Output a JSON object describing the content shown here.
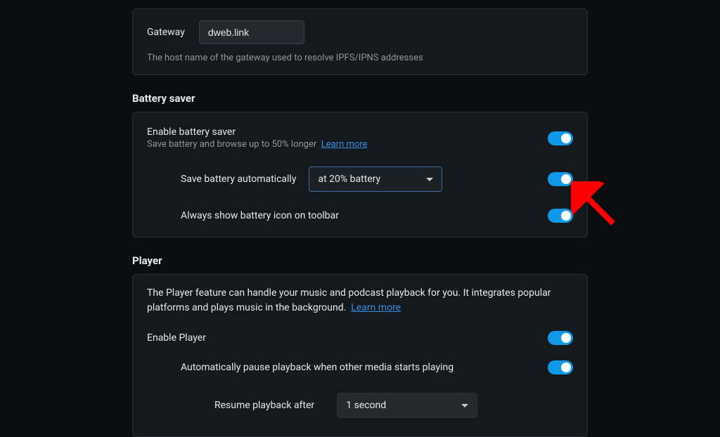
{
  "gateway": {
    "label": "Gateway",
    "value": "dweb.link",
    "help": "The host name of the gateway used to resolve IPFS/IPNS addresses"
  },
  "battery": {
    "heading": "Battery saver",
    "enable": {
      "title": "Enable battery saver",
      "sub": "Save battery and browse up to 50% longer",
      "learn": "Learn more"
    },
    "auto": {
      "label": "Save battery automatically",
      "selected": "at 20% battery"
    },
    "icon": {
      "title": "Always show battery icon on toolbar"
    }
  },
  "player": {
    "heading": "Player",
    "intro": "The Player feature can handle your music and podcast playback for you. It integrates popular platforms and plays music in the background.",
    "learn": "Learn more",
    "enable": {
      "title": "Enable Player"
    },
    "autopause": {
      "title": "Automatically pause playback when other media starts playing"
    },
    "resume": {
      "label": "Resume playback after",
      "selected": "1 second"
    }
  }
}
